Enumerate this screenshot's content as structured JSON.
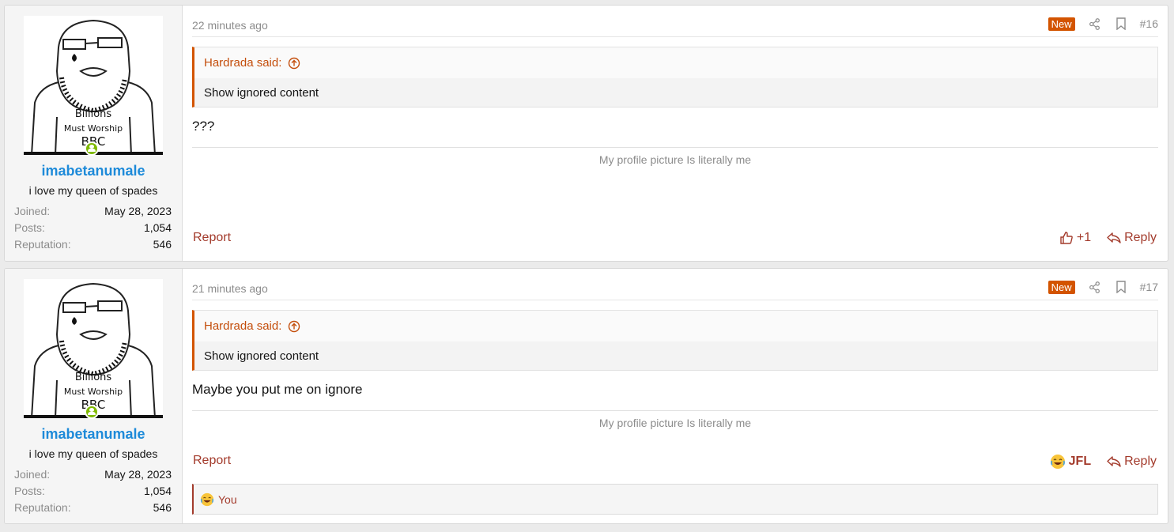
{
  "posts": [
    {
      "user": {
        "name": "imabetanumale",
        "title": "i love my queen of spades",
        "avatar_caption": "Billions Must Worship BBC",
        "stats": [
          {
            "label": "Joined:",
            "value": "May 28, 2023"
          },
          {
            "label": "Posts:",
            "value": "1,054"
          },
          {
            "label": "Reputation:",
            "value": "546"
          }
        ]
      },
      "time": "22 minutes ago",
      "badge": "New",
      "number": "#16",
      "quote": {
        "author": "Hardrada said:",
        "body": "Show ignored content"
      },
      "body": "???",
      "signature": "My profile picture Is literally me",
      "report": "Report",
      "reaction": "+1",
      "reply": "Reply"
    },
    {
      "user": {
        "name": "imabetanumale",
        "title": "i love my queen of spades",
        "avatar_caption": "Billions Must Worship BBC",
        "stats": [
          {
            "label": "Joined:",
            "value": "May 28, 2023"
          },
          {
            "label": "Posts:",
            "value": "1,054"
          },
          {
            "label": "Reputation:",
            "value": "546"
          }
        ]
      },
      "time": "21 minutes ago",
      "badge": "New",
      "number": "#17",
      "quote": {
        "author": "Hardrada said:",
        "body": "Show ignored content"
      },
      "body": "Maybe you put me on ignore",
      "signature": "My profile picture Is literally me",
      "report": "Report",
      "reaction": "JFL",
      "reply": "Reply",
      "reactions_summary": "You"
    }
  ],
  "icons": {
    "share": "share-icon",
    "bookmark": "bookmark-icon",
    "quote_jump": "arrow-up-circle-icon",
    "like": "thumbs-up-icon",
    "reply": "reply-arrow-icon",
    "laugh": "laughing-emoji-icon",
    "online": "online-status-icon"
  },
  "colors": {
    "username": "#1d8ad9",
    "accent": "#d35400",
    "action": "#a33b2c",
    "online": "#7fb900"
  }
}
